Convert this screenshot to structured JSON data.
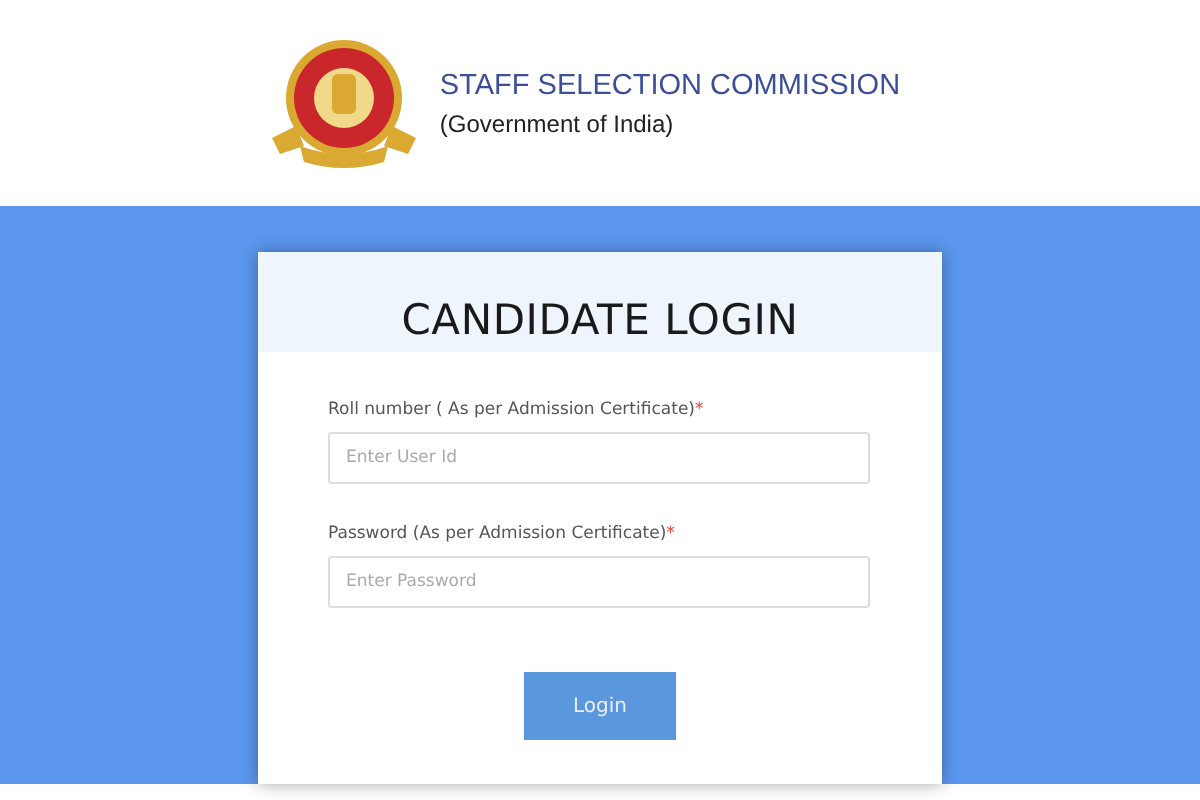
{
  "header": {
    "title": "STAFF SELECTION COMMISSION",
    "subtitle": "(Government of India)"
  },
  "login": {
    "title": "CANDIDATE LOGIN",
    "fields": [
      {
        "label": "Roll number ( As per Admission Certificate)",
        "required_mark": "*",
        "placeholder": "Enter User Id"
      },
      {
        "label": "Password (As per Admission Certificate)",
        "required_mark": "*",
        "placeholder": "Enter Password"
      }
    ],
    "button": "Login"
  }
}
